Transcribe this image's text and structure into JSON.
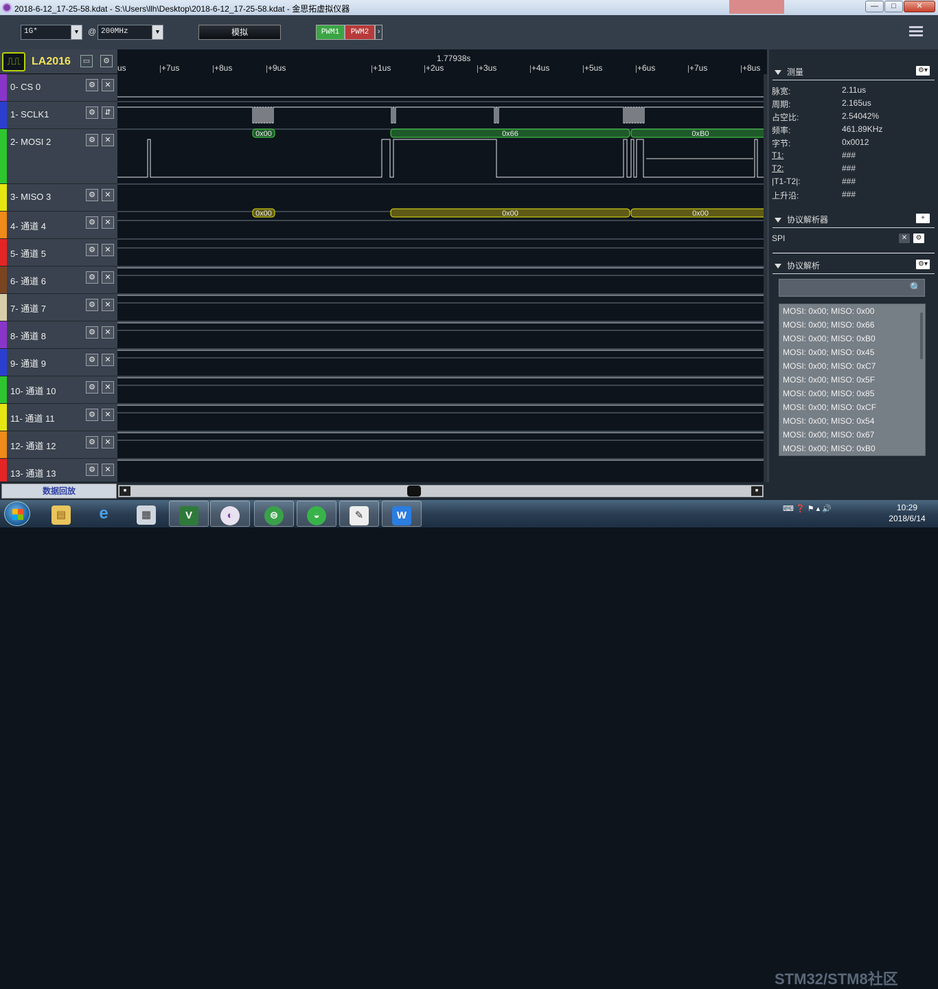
{
  "window": {
    "title": "2018-6-12_17-25-58.kdat - S:\\Users\\llh\\Desktop\\2018-6-12_17-25-58.kdat - 金思拓虚拟仪器",
    "minimize": "—",
    "maximize": "□",
    "close": "✕"
  },
  "toolbar": {
    "depth": "1G*",
    "at": "@",
    "rate": "200MHz",
    "simulate": "模拟",
    "pwm1": "PWM1",
    "pwm2": "PWM2",
    "pwm_more": "›"
  },
  "device": {
    "name": "LA2016"
  },
  "ruler": {
    "cursor_time": "1.77938s",
    "ticks": [
      "us",
      "+7us",
      "+8us",
      "+9us",
      "+1us",
      "+2us",
      "+3us",
      "+4us",
      "+5us",
      "+6us",
      "+7us",
      "+8us"
    ]
  },
  "channels": [
    {
      "label": "0-  CS 0",
      "color": "#8a35c9"
    },
    {
      "label": "1-  SCLK1",
      "color": "#2a3fd0"
    },
    {
      "label": "2-  MOSI 2",
      "color": "#2ec52e"
    },
    {
      "label": "3-  MISO 3",
      "color": "#e6e611"
    },
    {
      "label": "4-  通道 4",
      "color": "#f08a18"
    },
    {
      "label": "5-  通道 5",
      "color": "#e52424"
    },
    {
      "label": "6-  通道 6",
      "color": "#7b4420"
    },
    {
      "label": "7-  通道 7",
      "color": "#d8cfa8"
    },
    {
      "label": "8-  通道 8",
      "color": "#8a35c9"
    },
    {
      "label": "9-  通道 9",
      "color": "#2a3fd0"
    },
    {
      "label": "10- 通道 10",
      "color": "#2ec52e"
    },
    {
      "label": "11- 通道 11",
      "color": "#e6e611"
    },
    {
      "label": "12- 通道 12",
      "color": "#f08a18"
    },
    {
      "label": "13- 通道 13",
      "color": "#e52424"
    }
  ],
  "decoded": {
    "mosi": [
      "0x00",
      "0x66",
      "0xB0"
    ],
    "miso": [
      "0x00",
      "0x00",
      "0x00"
    ]
  },
  "measure": {
    "title": "测量",
    "rows": [
      {
        "label": "脉宽:",
        "value": "2.11us"
      },
      {
        "label": "周期:",
        "value": "2.165us"
      },
      {
        "label": "占空比:",
        "value": "2.54042%"
      },
      {
        "label": "频率:",
        "value": "461.89KHz"
      },
      {
        "label": "字节:",
        "value": "0x0012"
      },
      {
        "label": "T1:",
        "value": "###"
      },
      {
        "label": "T2:",
        "value": "###"
      },
      {
        "label": "|T1-T2|:",
        "value": "###"
      },
      {
        "label": "上升沿:",
        "value": "###"
      }
    ]
  },
  "analyzer": {
    "title": "协议解析器",
    "add": "+",
    "item": "SPI"
  },
  "parse": {
    "title": "协议解析",
    "search_placeholder": "",
    "items": [
      "MOSI: 0x00;  MISO: 0x00",
      "MOSI: 0x00;  MISO: 0x66",
      "MOSI: 0x00;  MISO: 0xB0",
      "MOSI: 0x00;  MISO: 0x45",
      "MOSI: 0x00;  MISO: 0xC7",
      "MOSI: 0x00;  MISO: 0x5F",
      "MOSI: 0x00;  MISO: 0x85",
      "MOSI: 0x00;  MISO: 0xCF",
      "MOSI: 0x00;  MISO: 0x54",
      "MOSI: 0x00;  MISO: 0x67",
      "MOSI: 0x00;  MISO: 0xB0"
    ]
  },
  "bottom": {
    "replay": "数据回放",
    "watermark": "STM32/STM8社区"
  },
  "taskbar": {
    "time": "10:29",
    "date": "2018/6/14"
  }
}
